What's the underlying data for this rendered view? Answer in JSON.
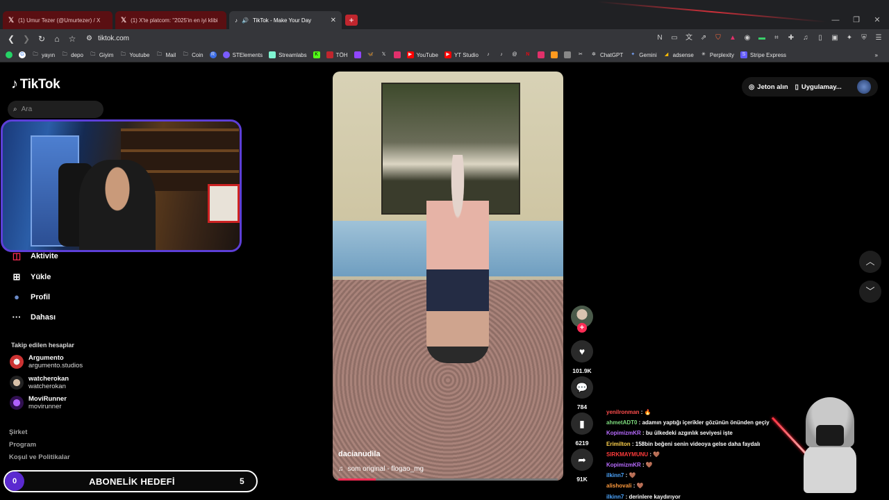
{
  "browser": {
    "tabs": [
      {
        "label": "(1) Umur Tezer (@Umurtezer) / X"
      },
      {
        "label": "(1) X'te platcom: \"2025'in en iyi klibi"
      },
      {
        "label": "TikTok - Make Your Day"
      }
    ],
    "new_tab": "+",
    "url": "tiktok.com",
    "bookmarks": [
      "yayın",
      "depo",
      "Giyim",
      "Youtube",
      "Mail",
      "Coin",
      "STElements",
      "Streamlabs",
      "TÖH",
      "YouTube",
      "YT Studio",
      "ChatGPT",
      "Gemini",
      "adsense",
      "Perplexity",
      "Stripe Express"
    ]
  },
  "tiktok": {
    "logo": "TikTok",
    "search_placeholder": "Ara",
    "sidebar": [
      {
        "label": "Aktivite",
        "icon": "activity-icon"
      },
      {
        "label": "Yükle",
        "icon": "upload-icon"
      },
      {
        "label": "Profil",
        "icon": "profile-icon"
      },
      {
        "label": "Dahası",
        "icon": "more-icon"
      }
    ],
    "following_title": "Takip edilen hesaplar",
    "following": [
      {
        "name": "Argumento",
        "handle": "argumento.studios"
      },
      {
        "name": "watcherokan",
        "handle": "watcherokan"
      },
      {
        "name": "MoviRunner",
        "handle": "movirunner"
      }
    ],
    "footer": [
      "Şirket",
      "Program",
      "Koşul ve Politikalar"
    ],
    "top_right": {
      "coins": "Jeton alın",
      "app": "Uygulamay..."
    },
    "video": {
      "author": "dacianudila",
      "music": "som original - flogao_mg",
      "progress": 0.17
    },
    "actions": {
      "likes": "101.9K",
      "comments": "784",
      "saves": "6219",
      "shares": "91K"
    }
  },
  "overlay": {
    "sub_goal": {
      "current": "0",
      "title": "ABONELİK HEDEFİ",
      "target": "5"
    },
    "chat": [
      {
        "user": "yenilronman",
        "color": "#ff4d4d",
        "msg": " : 🔥"
      },
      {
        "user": "ahmetADT0",
        "color": "#7ddc7d",
        "msg": " : adamın yaptığı içerikler gözünün önünden geçiy"
      },
      {
        "user": "KopimizmKR",
        "color": "#b86bff",
        "msg": " : bu ülkedeki azgınlık seviyesi işte"
      },
      {
        "user": "Erimilton",
        "color": "#ffd24d",
        "msg": " : 158bin beğeni senin videoya gelse daha faydalı"
      },
      {
        "user": "SIRKMAYMUNU",
        "color": "#ff3b3b",
        "msg": " : 🤎"
      },
      {
        "user": "KopimizmKR",
        "color": "#b86bff",
        "msg": " : 🤎"
      },
      {
        "user": "ilkinn7",
        "color": "#4da6ff",
        "msg": " : 🤎"
      },
      {
        "user": "alishovali",
        "color": "#ff9a3d",
        "msg": " : 🤎"
      },
      {
        "user": "ilkinn7",
        "color": "#4da6ff",
        "msg": " : derinlere kaydırıyor"
      }
    ]
  }
}
